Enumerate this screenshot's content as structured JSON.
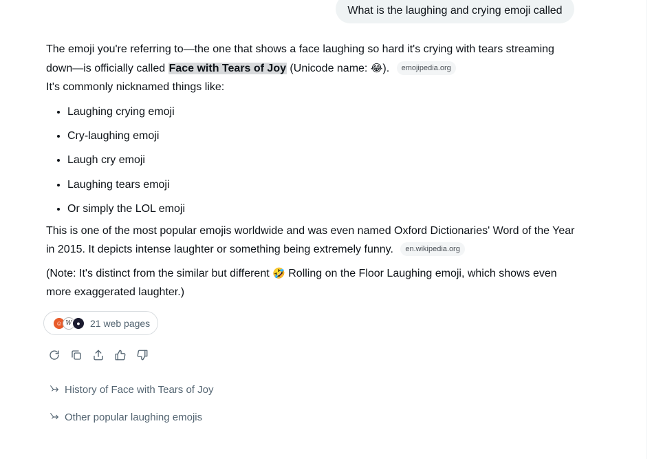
{
  "user_message": "What is the laughing and crying emoji called",
  "answer": {
    "intro_before": "The emoji you're referring to—the one that shows a face laughing so hard it's crying with tears streaming down—is officially called ",
    "official_name": "Face with Tears of Joy",
    "intro_after": " (Unicode name: ",
    "intro_emoji": "😂",
    "intro_end": ").",
    "intro_source": "emojipedia.org",
    "nickname_lead": "It's commonly nicknamed things like:",
    "nicknames": [
      "Laughing crying emoji",
      "Cry-laughing emoji",
      "Laugh cry emoji",
      "Laughing tears emoji",
      "Or simply the LOL emoji"
    ],
    "popularity": "This is one of the most popular emojis worldwide and was even named Oxford Dictionaries' Word of the Year in 2015. It depicts intense laughter or something being extremely funny.",
    "popularity_source": "en.wikipedia.org",
    "note_before": "(Note: It's distinct from the similar but different ",
    "note_emoji": "🤣",
    "note_after": " Rolling on the Floor Laughing emoji, which shows even more exaggerated laughter.)"
  },
  "sources": {
    "label": "21 web pages",
    "favicon_icons": [
      "emojipedia-favicon",
      "wikipedia-favicon",
      "site-favicon"
    ]
  },
  "actions": [
    {
      "name": "regenerate-icon"
    },
    {
      "name": "copy-icon"
    },
    {
      "name": "share-icon"
    },
    {
      "name": "thumbs-up-icon"
    },
    {
      "name": "thumbs-down-icon"
    }
  ],
  "followups": [
    "History of Face with Tears of Joy",
    "Other popular laughing emojis"
  ]
}
